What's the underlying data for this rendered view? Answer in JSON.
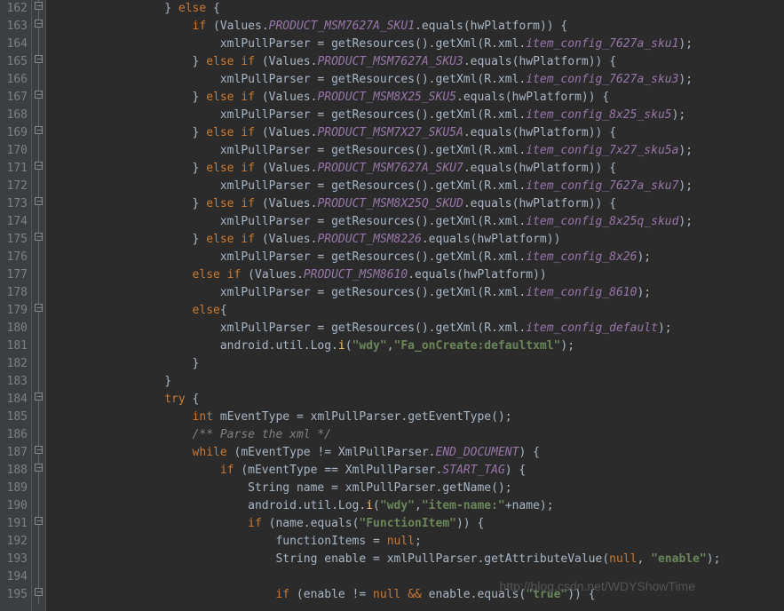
{
  "watermark": "http://blog.csdn.net/WDYShowTime",
  "gutter": {
    "start": 162,
    "end": 195
  },
  "fold_markers_at": [
    162,
    163,
    165,
    167,
    169,
    171,
    173,
    175,
    179,
    184,
    187,
    188,
    191,
    195
  ],
  "code_lines": [
    {
      "n": 162,
      "indent": 16,
      "tokens": [
        {
          "t": "p",
          "v": "} "
        },
        {
          "t": "kw",
          "v": "else"
        },
        {
          "t": "p",
          "v": " {"
        }
      ]
    },
    {
      "n": 163,
      "indent": 20,
      "tokens": [
        {
          "t": "kw",
          "v": "if"
        },
        {
          "t": "p",
          "v": " (Values."
        },
        {
          "t": "const",
          "v": "PRODUCT_MSM7627A_SKU1"
        },
        {
          "t": "p",
          "v": ".equals("
        },
        {
          "t": "id",
          "v": "hwPlatform"
        },
        {
          "t": "p",
          "v": ")) {"
        }
      ]
    },
    {
      "n": 164,
      "indent": 24,
      "tokens": [
        {
          "t": "id",
          "v": "xmlPullParser"
        },
        {
          "t": "p",
          "v": " = getResources().getXml(R.xml."
        },
        {
          "t": "const",
          "v": "item_config_7627a_sku1"
        },
        {
          "t": "p",
          "v": ");"
        }
      ]
    },
    {
      "n": 165,
      "indent": 20,
      "tokens": [
        {
          "t": "p",
          "v": "} "
        },
        {
          "t": "kw",
          "v": "else if"
        },
        {
          "t": "p",
          "v": " (Values."
        },
        {
          "t": "const",
          "v": "PRODUCT_MSM7627A_SKU3"
        },
        {
          "t": "p",
          "v": ".equals("
        },
        {
          "t": "id",
          "v": "hwPlatform"
        },
        {
          "t": "p",
          "v": ")) {"
        }
      ]
    },
    {
      "n": 166,
      "indent": 24,
      "tokens": [
        {
          "t": "id",
          "v": "xmlPullParser"
        },
        {
          "t": "p",
          "v": " = getResources().getXml(R.xml."
        },
        {
          "t": "const",
          "v": "item_config_7627a_sku3"
        },
        {
          "t": "p",
          "v": ");"
        }
      ]
    },
    {
      "n": 167,
      "indent": 20,
      "tokens": [
        {
          "t": "p",
          "v": "} "
        },
        {
          "t": "kw",
          "v": "else if"
        },
        {
          "t": "p",
          "v": " (Values."
        },
        {
          "t": "const",
          "v": "PRODUCT_MSM8X25_SKU5"
        },
        {
          "t": "p",
          "v": ".equals("
        },
        {
          "t": "id",
          "v": "hwPlatform"
        },
        {
          "t": "p",
          "v": ")) {"
        }
      ]
    },
    {
      "n": 168,
      "indent": 24,
      "tokens": [
        {
          "t": "id",
          "v": "xmlPullParser"
        },
        {
          "t": "p",
          "v": " = getResources().getXml(R.xml."
        },
        {
          "t": "const",
          "v": "item_config_8x25_sku5"
        },
        {
          "t": "p",
          "v": ");"
        }
      ]
    },
    {
      "n": 169,
      "indent": 20,
      "tokens": [
        {
          "t": "p",
          "v": "} "
        },
        {
          "t": "kw",
          "v": "else if"
        },
        {
          "t": "p",
          "v": " (Values."
        },
        {
          "t": "const",
          "v": "PRODUCT_MSM7X27_SKU5A"
        },
        {
          "t": "p",
          "v": ".equals("
        },
        {
          "t": "id",
          "v": "hwPlatform"
        },
        {
          "t": "p",
          "v": ")) {"
        }
      ]
    },
    {
      "n": 170,
      "indent": 24,
      "tokens": [
        {
          "t": "id",
          "v": "xmlPullParser"
        },
        {
          "t": "p",
          "v": " = getResources().getXml(R.xml."
        },
        {
          "t": "const",
          "v": "item_config_7x27_sku5a"
        },
        {
          "t": "p",
          "v": ");"
        }
      ]
    },
    {
      "n": 171,
      "indent": 20,
      "tokens": [
        {
          "t": "p",
          "v": "} "
        },
        {
          "t": "kw",
          "v": "else if"
        },
        {
          "t": "p",
          "v": " (Values."
        },
        {
          "t": "const",
          "v": "PRODUCT_MSM7627A_SKU7"
        },
        {
          "t": "p",
          "v": ".equals("
        },
        {
          "t": "id",
          "v": "hwPlatform"
        },
        {
          "t": "p",
          "v": ")) {"
        }
      ]
    },
    {
      "n": 172,
      "indent": 24,
      "tokens": [
        {
          "t": "id",
          "v": "xmlPullParser"
        },
        {
          "t": "p",
          "v": " = getResources().getXml(R.xml."
        },
        {
          "t": "const",
          "v": "item_config_7627a_sku7"
        },
        {
          "t": "p",
          "v": ");"
        }
      ]
    },
    {
      "n": 173,
      "indent": 20,
      "tokens": [
        {
          "t": "p",
          "v": "} "
        },
        {
          "t": "kw",
          "v": "else if"
        },
        {
          "t": "p",
          "v": " (Values."
        },
        {
          "t": "const",
          "v": "PRODUCT_MSM8X25Q_SKUD"
        },
        {
          "t": "p",
          "v": ".equals("
        },
        {
          "t": "id",
          "v": "hwPlatform"
        },
        {
          "t": "p",
          "v": ")) {"
        }
      ]
    },
    {
      "n": 174,
      "indent": 24,
      "tokens": [
        {
          "t": "id",
          "v": "xmlPullParser"
        },
        {
          "t": "p",
          "v": " = getResources().getXml(R.xml."
        },
        {
          "t": "const",
          "v": "item_config_8x25q_skud"
        },
        {
          "t": "p",
          "v": ");"
        }
      ]
    },
    {
      "n": 175,
      "indent": 20,
      "tokens": [
        {
          "t": "p",
          "v": "} "
        },
        {
          "t": "kw",
          "v": "else if"
        },
        {
          "t": "p",
          "v": " (Values."
        },
        {
          "t": "const",
          "v": "PRODUCT_MSM8226"
        },
        {
          "t": "p",
          "v": ".equals("
        },
        {
          "t": "id",
          "v": "hwPlatform"
        },
        {
          "t": "p",
          "v": "))"
        }
      ]
    },
    {
      "n": 176,
      "indent": 24,
      "tokens": [
        {
          "t": "id",
          "v": "xmlPullParser"
        },
        {
          "t": "p",
          "v": " = getResources().getXml(R.xml."
        },
        {
          "t": "const",
          "v": "item_config_8x26"
        },
        {
          "t": "p",
          "v": ");"
        }
      ]
    },
    {
      "n": 177,
      "indent": 20,
      "tokens": [
        {
          "t": "kw",
          "v": "else if"
        },
        {
          "t": "p",
          "v": " (Values."
        },
        {
          "t": "const",
          "v": "PRODUCT_MSM8610"
        },
        {
          "t": "p",
          "v": ".equals("
        },
        {
          "t": "id",
          "v": "hwPlatform"
        },
        {
          "t": "p",
          "v": "))"
        }
      ]
    },
    {
      "n": 178,
      "indent": 24,
      "tokens": [
        {
          "t": "id",
          "v": "xmlPullParser"
        },
        {
          "t": "p",
          "v": " = getResources().getXml(R.xml."
        },
        {
          "t": "const",
          "v": "item_config_8610"
        },
        {
          "t": "p",
          "v": ");"
        }
      ]
    },
    {
      "n": 179,
      "indent": 20,
      "tokens": [
        {
          "t": "kw",
          "v": "else"
        },
        {
          "t": "p",
          "v": "{"
        }
      ]
    },
    {
      "n": 180,
      "indent": 24,
      "tokens": [
        {
          "t": "id",
          "v": "xmlPullParser"
        },
        {
          "t": "p",
          "v": " = getResources().getXml(R.xml."
        },
        {
          "t": "const",
          "v": "item_config_default"
        },
        {
          "t": "p",
          "v": ");"
        }
      ]
    },
    {
      "n": 181,
      "indent": 24,
      "tokens": [
        {
          "t": "id",
          "v": "android.util.Log"
        },
        {
          "t": "p",
          "v": "."
        },
        {
          "t": "fn",
          "v": "i"
        },
        {
          "t": "p",
          "v": "("
        },
        {
          "t": "str",
          "v": "\"wdy\""
        },
        {
          "t": "p",
          "v": ","
        },
        {
          "t": "str",
          "v": "\"Fa_onCreate:defaultxml\""
        },
        {
          "t": "p",
          "v": ");"
        }
      ]
    },
    {
      "n": 182,
      "indent": 20,
      "tokens": [
        {
          "t": "p",
          "v": "}"
        }
      ]
    },
    {
      "n": 183,
      "indent": 16,
      "tokens": [
        {
          "t": "p",
          "v": "}"
        }
      ]
    },
    {
      "n": 184,
      "indent": 16,
      "tokens": [
        {
          "t": "kw",
          "v": "try"
        },
        {
          "t": "p",
          "v": " {"
        }
      ]
    },
    {
      "n": 185,
      "indent": 20,
      "tokens": [
        {
          "t": "kw",
          "v": "int"
        },
        {
          "t": "p",
          "v": " "
        },
        {
          "t": "id",
          "v": "mEventType"
        },
        {
          "t": "p",
          "v": " = "
        },
        {
          "t": "id",
          "v": "xmlPullParser"
        },
        {
          "t": "p",
          "v": ".getEventType();"
        }
      ]
    },
    {
      "n": 186,
      "indent": 20,
      "tokens": [
        {
          "t": "cmt",
          "v": "/** Parse the xml */"
        }
      ]
    },
    {
      "n": 187,
      "indent": 20,
      "tokens": [
        {
          "t": "kw",
          "v": "while"
        },
        {
          "t": "p",
          "v": " ("
        },
        {
          "t": "id",
          "v": "mEventType"
        },
        {
          "t": "p",
          "v": " != XmlPullParser."
        },
        {
          "t": "const",
          "v": "END_DOCUMENT"
        },
        {
          "t": "p",
          "v": ") {"
        }
      ]
    },
    {
      "n": 188,
      "indent": 24,
      "tokens": [
        {
          "t": "kw",
          "v": "if"
        },
        {
          "t": "p",
          "v": " ("
        },
        {
          "t": "id",
          "v": "mEventType"
        },
        {
          "t": "p",
          "v": " == XmlPullParser."
        },
        {
          "t": "const",
          "v": "START_TAG"
        },
        {
          "t": "p",
          "v": ") {"
        }
      ]
    },
    {
      "n": 189,
      "indent": 28,
      "tokens": [
        {
          "t": "cls",
          "v": "String"
        },
        {
          "t": "p",
          "v": " "
        },
        {
          "t": "id",
          "v": "name"
        },
        {
          "t": "p",
          "v": " = "
        },
        {
          "t": "id",
          "v": "xmlPullParser"
        },
        {
          "t": "p",
          "v": ".getName();"
        }
      ]
    },
    {
      "n": 190,
      "indent": 28,
      "tokens": [
        {
          "t": "id",
          "v": "android.util.Log"
        },
        {
          "t": "p",
          "v": "."
        },
        {
          "t": "fn",
          "v": "i"
        },
        {
          "t": "p",
          "v": "("
        },
        {
          "t": "str",
          "v": "\"wdy\""
        },
        {
          "t": "p",
          "v": ","
        },
        {
          "t": "str",
          "v": "\"item-name:\""
        },
        {
          "t": "p",
          "v": "+"
        },
        {
          "t": "id",
          "v": "name"
        },
        {
          "t": "p",
          "v": ");"
        }
      ]
    },
    {
      "n": 191,
      "indent": 28,
      "tokens": [
        {
          "t": "kw",
          "v": "if"
        },
        {
          "t": "p",
          "v": " ("
        },
        {
          "t": "id",
          "v": "name"
        },
        {
          "t": "p",
          "v": ".equals("
        },
        {
          "t": "str",
          "v": "\"FunctionItem\""
        },
        {
          "t": "p",
          "v": ")) {"
        }
      ]
    },
    {
      "n": 192,
      "indent": 32,
      "tokens": [
        {
          "t": "id",
          "v": "functionItems"
        },
        {
          "t": "p",
          "v": " = "
        },
        {
          "t": "kw",
          "v": "null"
        },
        {
          "t": "p",
          "v": ";"
        }
      ]
    },
    {
      "n": 193,
      "indent": 32,
      "tokens": [
        {
          "t": "cls",
          "v": "String"
        },
        {
          "t": "p",
          "v": " "
        },
        {
          "t": "id",
          "v": "enable"
        },
        {
          "t": "p",
          "v": " = "
        },
        {
          "t": "id",
          "v": "xmlPullParser"
        },
        {
          "t": "p",
          "v": ".getAttributeValue("
        },
        {
          "t": "kw",
          "v": "null"
        },
        {
          "t": "p",
          "v": ", "
        },
        {
          "t": "str",
          "v": "\"enable\""
        },
        {
          "t": "p",
          "v": ");"
        }
      ]
    },
    {
      "n": 194,
      "indent": 32,
      "tokens": []
    },
    {
      "n": 195,
      "indent": 32,
      "tokens": [
        {
          "t": "kw",
          "v": "if"
        },
        {
          "t": "p",
          "v": " ("
        },
        {
          "t": "id",
          "v": "enable"
        },
        {
          "t": "p",
          "v": " != "
        },
        {
          "t": "kw",
          "v": "null"
        },
        {
          "t": "p",
          "v": " "
        },
        {
          "t": "kw",
          "v": "&&"
        },
        {
          "t": "p",
          "v": " "
        },
        {
          "t": "id",
          "v": "enable"
        },
        {
          "t": "p",
          "v": ".equals("
        },
        {
          "t": "str",
          "v": "\"true\""
        },
        {
          "t": "p",
          "v": ")) {"
        }
      ]
    }
  ]
}
